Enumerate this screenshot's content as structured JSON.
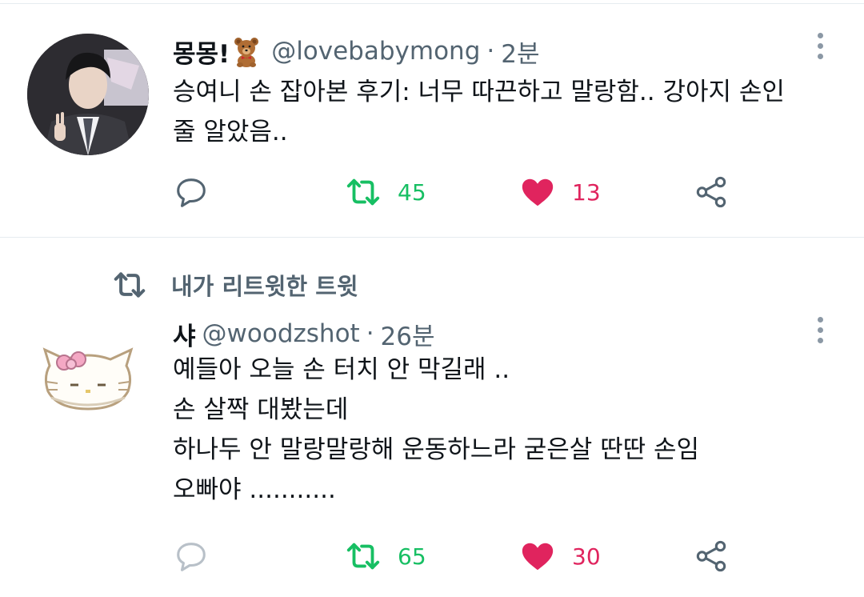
{
  "tweets": [
    {
      "display_name": "몽몽!",
      "emoji": "teddy-bear",
      "handle": "@lovebabymong",
      "dot": "·",
      "time": "2분",
      "lines": [
        "승여니 손 잡아본 후기: 너무 따끈하고 말랑함.. 강아지 손인",
        "줄 알았음.."
      ],
      "retweets": "45",
      "likes": "13",
      "liked": true,
      "retweeted": false
    },
    {
      "retweet_banner": "내가 리트윗한 트윗",
      "display_name": "샤",
      "handle": "@woodzshot",
      "dot": "·",
      "time": "26분",
      "lines": [
        "예들아 오늘 손 터치 안 막길래 ..",
        "손 살짝 대봤는데",
        "하나두 안 말랑말랑해 운동하느라 굳은살 딴딴 손임",
        "오빠야 ..........."
      ],
      "retweets": "65",
      "likes": "30",
      "liked": true,
      "retweeted": true
    }
  ],
  "colors": {
    "retweet_green": "#17bf63",
    "like_pink": "#e0245e",
    "secondary_text": "#536471",
    "divider": "#e6ecf0"
  },
  "icons": [
    "reply-icon",
    "retweet-icon",
    "like-icon",
    "share-icon",
    "more-icon",
    "teddy-bear-emoji",
    "hello-kitty-avatar"
  ]
}
